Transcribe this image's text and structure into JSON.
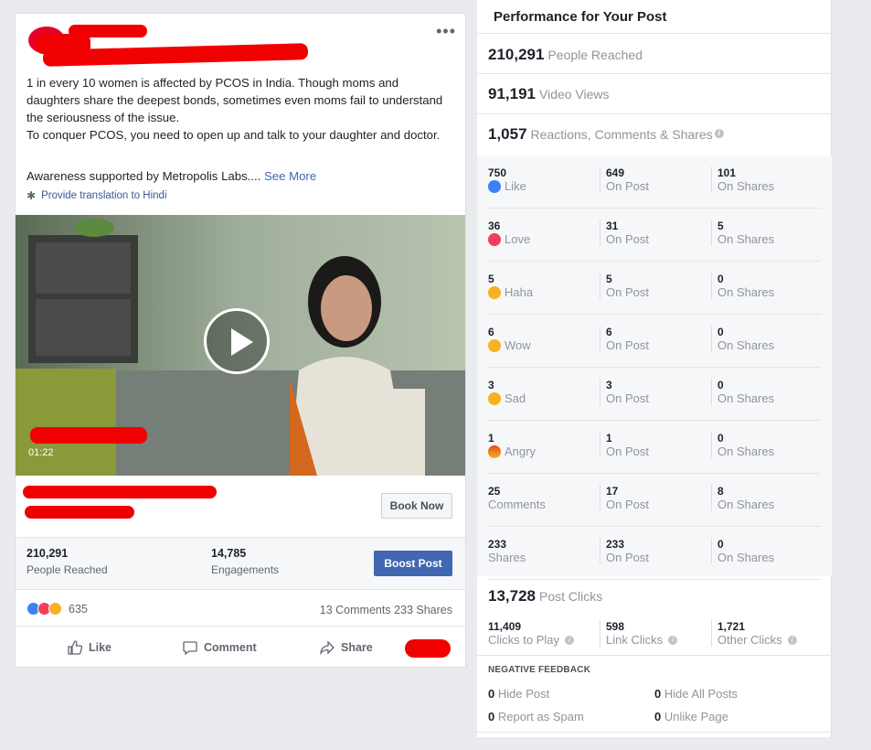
{
  "post": {
    "menu_glyph": "•••",
    "text": "1 in every 10 women is affected by PCOS in India. Though moms and daughters share the deepest bonds, sometimes even moms fail to understand the seriousness of the issue.\nTo conquer PCOS, you need to open up and talk to your daughter and doctor.",
    "support": "Awareness supported by Metropolis Labs.... ",
    "see_more": "See More",
    "translate": "Provide translation to Hindi",
    "video_duration": "01:22",
    "book_now": "Book Now",
    "people_reached_num": "210,291",
    "people_reached_lbl": "People Reached",
    "engagements_num": "14,785",
    "engagements_lbl": "Engagements",
    "boost_label": "Boost Post",
    "reaction_count": "635",
    "comments": "13 Comments",
    "shares": "233 Shares",
    "like_label": "Like",
    "comment_label": "Comment",
    "share_label": "Share"
  },
  "panel": {
    "title": "Performance for Your Post",
    "reached_num": "210,291",
    "reached_lbl": "People Reached",
    "views_num": "91,191",
    "views_lbl": "Video Views",
    "rcs_num": "1,057",
    "rcs_lbl": "Reactions, Comments & Shares",
    "rows": [
      {
        "total": "750",
        "label": "Like",
        "icon": "like-icon",
        "on_post": "649",
        "on_post_lbl": "On Post",
        "on_shares": "101",
        "on_shares_lbl": "On Shares"
      },
      {
        "total": "36",
        "label": "Love",
        "icon": "love-icon",
        "on_post": "31",
        "on_post_lbl": "On Post",
        "on_shares": "5",
        "on_shares_lbl": "On Shares"
      },
      {
        "total": "5",
        "label": "Haha",
        "icon": "haha-icon",
        "on_post": "5",
        "on_post_lbl": "On Post",
        "on_shares": "0",
        "on_shares_lbl": "On Shares"
      },
      {
        "total": "6",
        "label": "Wow",
        "icon": "wow-icon",
        "on_post": "6",
        "on_post_lbl": "On Post",
        "on_shares": "0",
        "on_shares_lbl": "On Shares"
      },
      {
        "total": "3",
        "label": "Sad",
        "icon": "sad-icon",
        "on_post": "3",
        "on_post_lbl": "On Post",
        "on_shares": "0",
        "on_shares_lbl": "On Shares"
      },
      {
        "total": "1",
        "label": "Angry",
        "icon": "angry-icon",
        "on_post": "1",
        "on_post_lbl": "On Post",
        "on_shares": "0",
        "on_shares_lbl": "On Shares"
      },
      {
        "total": "25",
        "label": "Comments",
        "icon": "",
        "on_post": "17",
        "on_post_lbl": "On Post",
        "on_shares": "8",
        "on_shares_lbl": "On Shares"
      },
      {
        "total": "233",
        "label": "Shares",
        "icon": "",
        "on_post": "233",
        "on_post_lbl": "On Post",
        "on_shares": "0",
        "on_shares_lbl": "On Shares"
      }
    ],
    "clicks_num": "13,728",
    "clicks_lbl": "Post Clicks",
    "clicks_play_num": "11,409",
    "clicks_play_lbl": "Clicks to Play",
    "link_clicks_num": "598",
    "link_clicks_lbl": "Link Clicks",
    "other_clicks_num": "1,721",
    "other_clicks_lbl": "Other Clicks",
    "negative_title": "NEGATIVE FEEDBACK",
    "hide_post_num": "0",
    "hide_post_lbl": "Hide Post",
    "hide_all_num": "0",
    "hide_all_lbl": "Hide All Posts",
    "spam_num": "0",
    "spam_lbl": "Report as Spam",
    "unlike_num": "0",
    "unlike_lbl": "Unlike Page"
  },
  "colors": {
    "brand_blue": "#4267b2",
    "redaction": "#f00000"
  }
}
